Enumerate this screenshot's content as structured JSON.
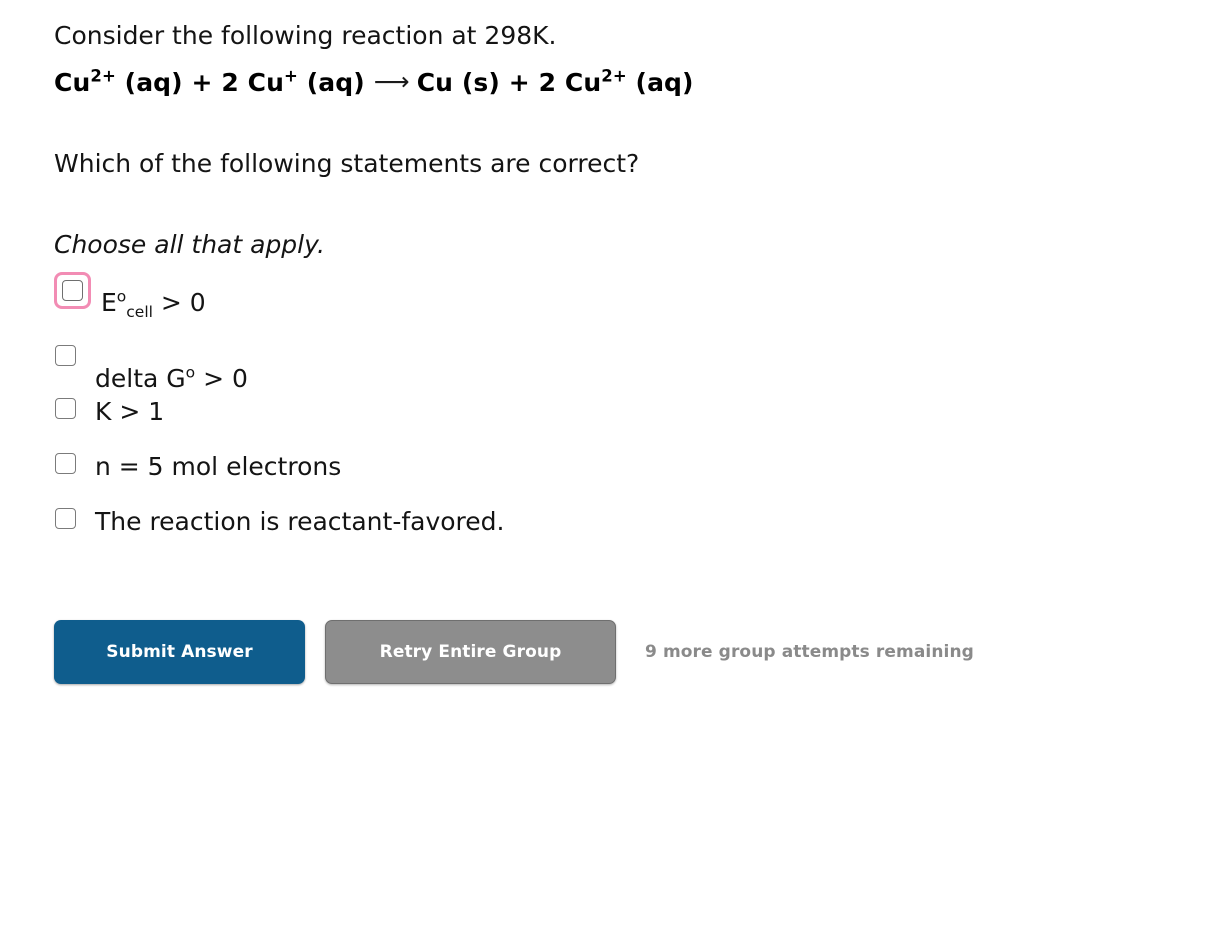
{
  "prompt": {
    "intro": "Consider the following reaction at 298K.",
    "equation": {
      "reactant1": "Cu",
      "reactant1_charge": "2+",
      "reactant1_state": " (aq) + 2 ",
      "reactant2": "Cu",
      "reactant2_charge": "+",
      "reactant2_state": " (aq)",
      "arrow": "⟶",
      "product1": "Cu (s) + 2 ",
      "product2": "Cu",
      "product2_charge": "2+",
      "product2_state": " (aq)",
      "plain_text": "Cu2+ (aq) + 2 Cu+ (aq) ⟶ Cu (s) + 2 Cu2+ (aq)"
    },
    "question": "Which of the following statements are correct?",
    "instruction": "Choose all that apply."
  },
  "options": [
    {
      "id": "opt-0",
      "text_main": "E",
      "text_sup": "o",
      "text_sub": "cell",
      "text_tail": " > 0",
      "plain_text": "E°cell > 0",
      "checked": false,
      "focused": true
    },
    {
      "id": "opt-1",
      "text_main": "delta G",
      "text_sup": "o",
      "text_sub": "",
      "text_tail": " > 0",
      "plain_text": "delta G° > 0",
      "checked": false,
      "focused": false
    },
    {
      "id": "opt-2",
      "text_main": "K > 1",
      "text_sup": "",
      "text_sub": "",
      "text_tail": "",
      "plain_text": "K > 1",
      "checked": false,
      "focused": false
    },
    {
      "id": "opt-3",
      "text_main": "n = 5 mol electrons",
      "text_sup": "",
      "text_sub": "",
      "text_tail": "",
      "plain_text": "n = 5 mol electrons",
      "checked": false,
      "focused": false
    },
    {
      "id": "opt-4",
      "text_main": "The reaction is reactant-favored.",
      "text_sup": "",
      "text_sub": "",
      "text_tail": "",
      "plain_text": "The reaction is reactant-favored.",
      "checked": false,
      "focused": false
    }
  ],
  "actions": {
    "submit_label": "Submit Answer",
    "retry_label": "Retry Entire Group",
    "attempts_text": "9 more group attempts remaining"
  },
  "colors": {
    "submit_button": "#0f5d8d",
    "retry_button": "#8d8d8d",
    "focus_ring": "#f28cb4",
    "attempts_text": "#8a8a8a",
    "checkbox_border": "#7b7b7b",
    "page_background": "#ffffff",
    "body_text": "#141414"
  }
}
